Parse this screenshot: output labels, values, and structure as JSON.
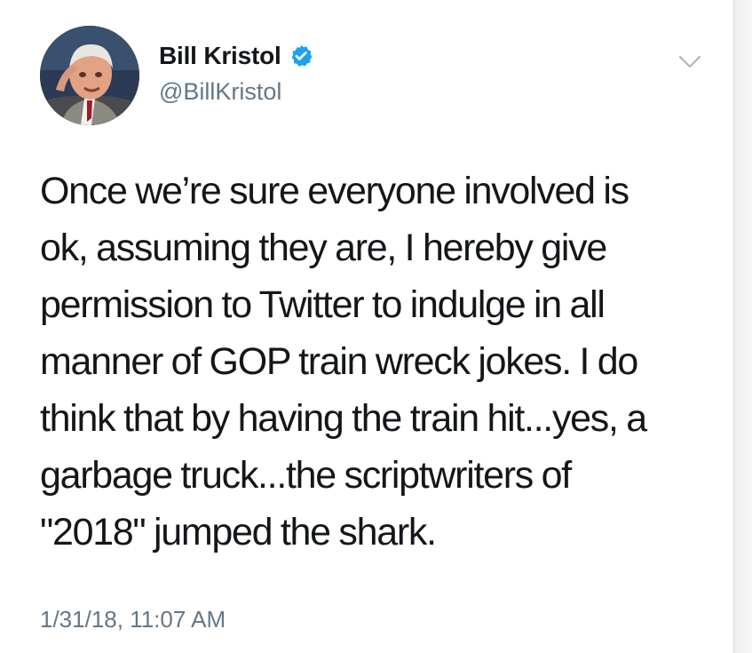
{
  "tweet": {
    "author": {
      "display_name": "Bill Kristol",
      "handle": "@BillKristol",
      "verified": true,
      "avatar_icon": "profile-photo"
    },
    "text": "Once we’re sure everyone involved is\nok, assuming they are, I hereby give\npermission to Twitter to indulge in all\nmanner of GOP train wreck jokes. I do\nthink that by having the train hit...yes, a\ngarbage truck...the scriptwriters of\n\"2018\" jumped the shark.",
    "timestamp": "1/31/18, 11:07 AM",
    "menu_icon": "chevron-down-icon"
  },
  "colors": {
    "text_primary": "#14171a",
    "text_secondary": "#657786",
    "verified_blue": "#1da1f2",
    "caret_gray": "#aab8c2"
  }
}
